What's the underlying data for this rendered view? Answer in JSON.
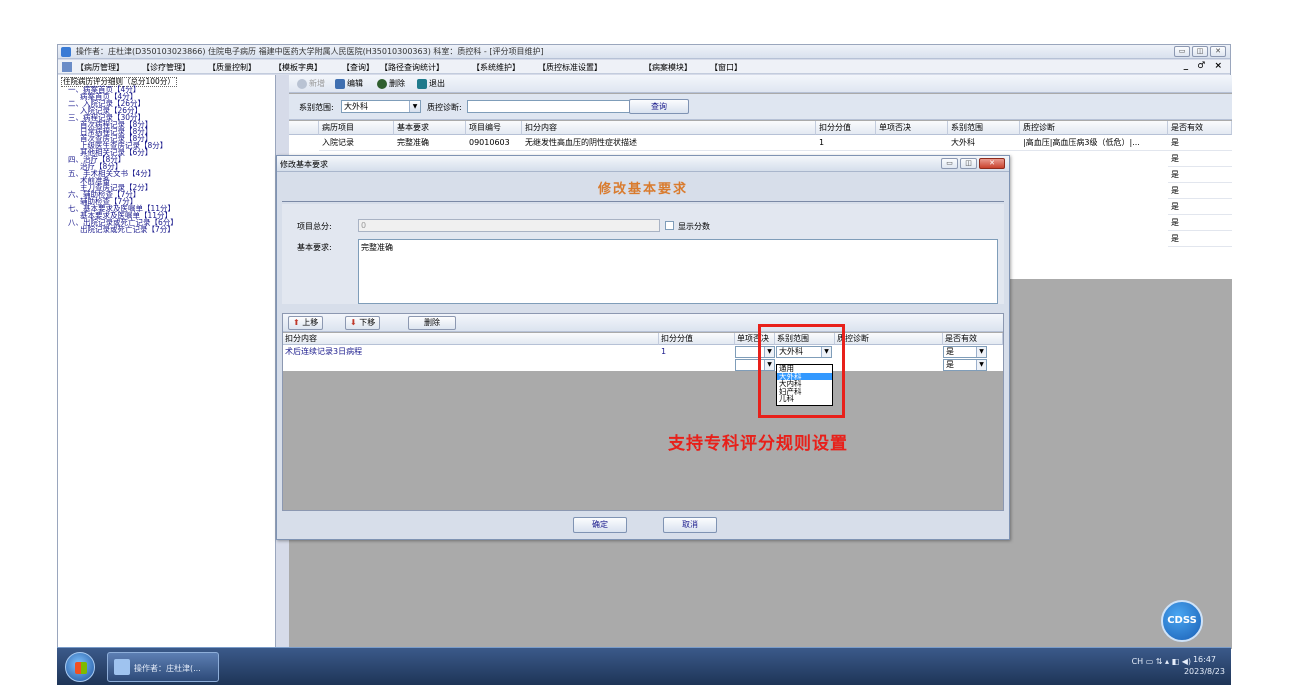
{
  "window": {
    "title": "操作者：庄杜津(D350103023866) 住院电子病历 福建中医药大学附属人民医院(H35010300363) 科室：质控科 - [评分项目维护]"
  },
  "menubar": {
    "items": [
      "【病历管理】",
      "【诊疗管理】",
      "【质量控制】",
      "【模板字典】",
      "【查询】",
      "【路径查询统计】",
      "【系统维护】",
      "【质控标准设置】",
      "【病案模块】",
      "【窗口】"
    ],
    "controls": "_ ♂ ×"
  },
  "tree": {
    "nodes": [
      "住院病历评分细则（总分100分）",
      "一、病案首页【4分】",
      "病案首页【4分】",
      "二、入院记录【26分】",
      "入院记录【26分】",
      "三、病程记录【30分】",
      "首次病程记录【8分】",
      "日常病程记录【8分】",
      "首次查房记录【8分】",
      "上级医生查房记录【8分】",
      "其他相关记录【6分】",
      "四、治疗【8分】",
      "治疗【8分】",
      "五、手术相关文书【4分】",
      "术前准备",
      "主刀查房记录【2分】",
      "六、辅助检查【7分】",
      "辅助检查【7分】",
      "七、基本要求及医嘱单【11分】",
      "基本要求及医嘱单【11分】",
      "八、出院记录或死亡记录【6分】",
      "出院记录或死亡记录【7分】"
    ]
  },
  "toolbar": {
    "new_label": "新增",
    "edit_label": "编辑",
    "delete_label": "删除",
    "exit_label": "退出"
  },
  "filter": {
    "range_label": "系别范围:",
    "range_value": "大外科",
    "diag_label": "质控诊断:",
    "query_label": "查询"
  },
  "grid": {
    "headers": [
      "病历项目",
      "基本要求",
      "项目编号",
      "扣分内容",
      "扣分分值",
      "单项否决",
      "系别范围",
      "质控诊断",
      "是否有效"
    ],
    "row": {
      "item": "入院记录",
      "req": "完整准确",
      "code": "09010603",
      "content": "无继发性高血压的阴性症状描述",
      "score": "1",
      "veto": "",
      "range": "大外科",
      "diag": "|高血压|高血压病3级（低危）|...",
      "valid": "是"
    },
    "valid_rows": [
      "是",
      "是",
      "是",
      "是",
      "是",
      "是"
    ]
  },
  "dialog": {
    "title": "修改基本要求",
    "heading": "修改基本要求",
    "total_label": "项目总分:",
    "total_value": "0",
    "show_score_label": "显示分数",
    "req_label": "基本要求:",
    "req_value": "完整准确",
    "up_label": "上移",
    "down_label": "下移",
    "delete_label": "删除",
    "sub_headers": [
      "扣分内容",
      "扣分分值",
      "单项否决",
      "系别范围",
      "质控诊断",
      "是否有效"
    ],
    "sub_row": {
      "content": "术后连续记录3日病程",
      "score": "1",
      "range": "大外科",
      "valid": "是"
    },
    "sub_row2_valid": "是",
    "dropdown_options": [
      "通用",
      "大外科",
      "大内科",
      "妇产科",
      "儿科"
    ],
    "confirm_label": "确定",
    "cancel_label": "取消"
  },
  "annotation": "支持专科评分规则设置",
  "cdss_label": "CDSS",
  "taskbar": {
    "item_label": "操作者：庄杜津(...",
    "tray": "CH ▭ ⇅ ▴ ◧ ◀)",
    "time": "16:47",
    "date": "2023/8/23"
  },
  "colors": {
    "annotation_red": "#e8201a",
    "heading_orange": "#d97b2e",
    "selection_blue": "#3399ff"
  }
}
